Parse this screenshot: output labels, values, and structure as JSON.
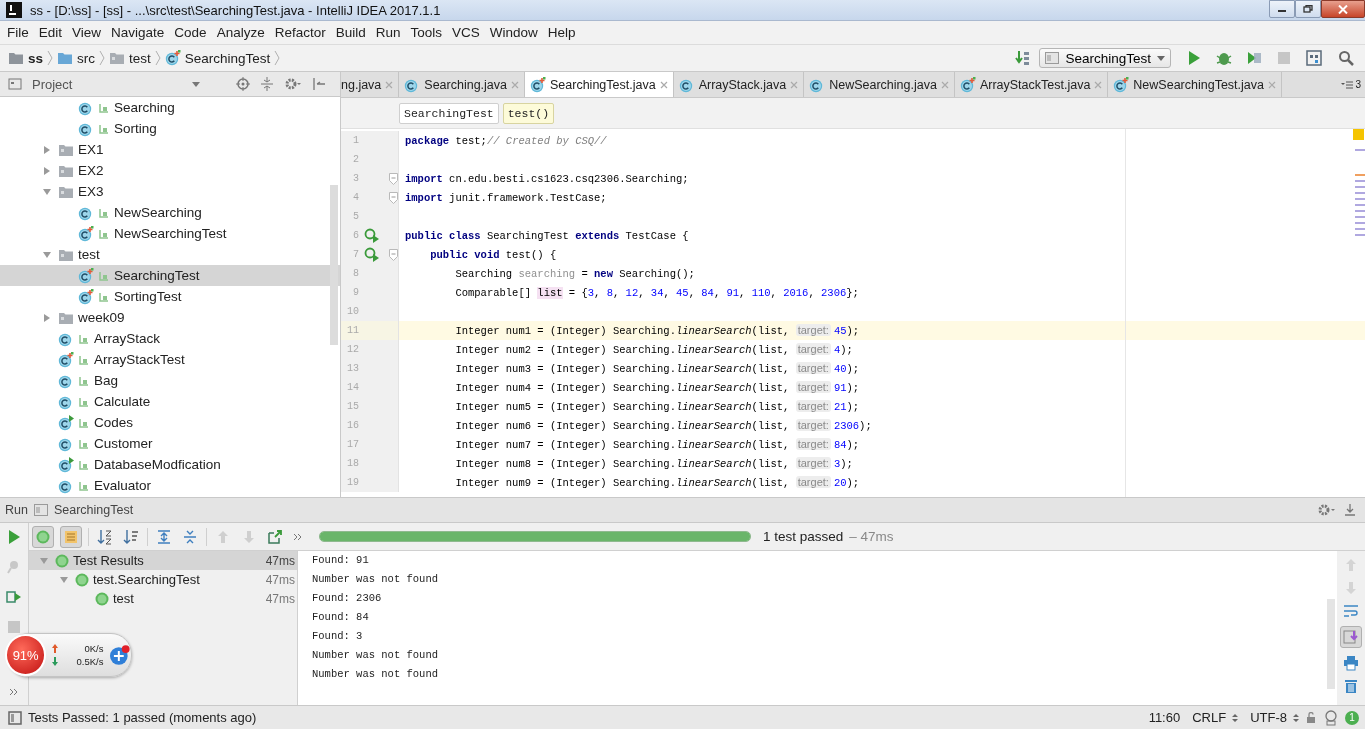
{
  "window": {
    "title": "ss - [D:\\ss] - [ss] - ...\\src\\test\\SearchingTest.java - IntelliJ IDEA 2017.1.1"
  },
  "menu": [
    "File",
    "Edit",
    "View",
    "Navigate",
    "Code",
    "Analyze",
    "Refactor",
    "Build",
    "Run",
    "Tools",
    "VCS",
    "Window",
    "Help"
  ],
  "navigation": {
    "breadcrumbs": [
      {
        "label": "ss",
        "kind": "project"
      },
      {
        "label": "src",
        "kind": "source"
      },
      {
        "label": "test",
        "kind": "folder"
      },
      {
        "label": "SearchingTest",
        "kind": "test"
      }
    ],
    "run_configuration": "SearchingTest"
  },
  "project": {
    "title": "Project",
    "continued": [
      {
        "label": "Searching",
        "kind": "class",
        "selected": false
      },
      {
        "label": "Sorting",
        "kind": "class",
        "selected": false
      }
    ],
    "items": [
      {
        "label": "EX1",
        "kind": "folder",
        "expanded": false,
        "selected": false
      },
      {
        "label": "EX2",
        "kind": "folder",
        "expanded": false,
        "selected": false
      },
      {
        "label": "EX3",
        "kind": "folder",
        "expanded": true,
        "selected": false,
        "children": [
          {
            "label": "NewSearching",
            "kind": "class",
            "selected": false
          },
          {
            "label": "NewSearchingTest",
            "kind": "test",
            "selected": false
          }
        ]
      },
      {
        "label": "test",
        "kind": "folder",
        "expanded": true,
        "selected": false,
        "children": [
          {
            "label": "SearchingTest",
            "kind": "test",
            "selected": true
          },
          {
            "label": "SortingTest",
            "kind": "test",
            "selected": false
          }
        ]
      },
      {
        "label": "week09",
        "kind": "folder",
        "expanded": false,
        "selected": false
      },
      {
        "label": "ArrayStack",
        "kind": "class",
        "selected": false
      },
      {
        "label": "ArrayStackTest",
        "kind": "test",
        "selected": false
      },
      {
        "label": "Bag",
        "kind": "class",
        "selected": false
      },
      {
        "label": "Calculate",
        "kind": "class",
        "selected": false
      },
      {
        "label": "Codes",
        "kind": "main",
        "selected": false
      },
      {
        "label": "Customer",
        "kind": "class",
        "selected": false
      },
      {
        "label": "DatabaseModfication",
        "kind": "main",
        "selected": false
      },
      {
        "label": "Evaluator",
        "kind": "class",
        "selected": false
      }
    ]
  },
  "editor": {
    "tabs": [
      {
        "label": "ng.java",
        "kind": "class",
        "selected": false
      },
      {
        "label": "Searching.java",
        "kind": "class",
        "selected": false
      },
      {
        "label": "SearchingTest.java",
        "kind": "test",
        "selected": true
      },
      {
        "label": "ArrayStack.java",
        "kind": "class",
        "selected": false
      },
      {
        "label": "NewSearching.java",
        "kind": "class",
        "selected": false
      },
      {
        "label": "ArrayStackTest.java",
        "kind": "test",
        "selected": false
      },
      {
        "label": "NewSearchingTest.java",
        "kind": "test",
        "selected": false
      }
    ],
    "hidden_tab_count": "3",
    "crumbs": [
      {
        "label": "SearchingTest",
        "selected": false
      },
      {
        "label": "test()",
        "selected": true
      }
    ],
    "lines": [
      {
        "number": "1",
        "run_marker": false,
        "fold": false,
        "selected": false,
        "tokens": [
          {
            "kind": "keyword",
            "text": "package"
          },
          {
            "kind": "text",
            "text": " test;"
          },
          {
            "kind": "comment",
            "text": "// Created by CSQ//"
          }
        ]
      },
      {
        "number": "2",
        "run_marker": false,
        "fold": false,
        "selected": false
      },
      {
        "number": "3",
        "run_marker": false,
        "fold": true,
        "selected": false,
        "tokens": [
          {
            "kind": "keyword",
            "text": "import"
          },
          {
            "kind": "text",
            "text": " cn.edu.besti.cs1623.csq2306.Searching;"
          }
        ]
      },
      {
        "number": "4",
        "run_marker": false,
        "fold": true,
        "selected": false,
        "tokens": [
          {
            "kind": "keyword",
            "text": "import"
          },
          {
            "kind": "text",
            "text": " junit.framework.TestCase;"
          }
        ]
      },
      {
        "number": "5",
        "run_marker": false,
        "fold": false,
        "selected": false
      },
      {
        "number": "6",
        "run_marker": true,
        "fold": false,
        "selected": false,
        "tokens": [
          {
            "kind": "keyword",
            "text": "public class"
          },
          {
            "kind": "text",
            "text": " SearchingTest "
          },
          {
            "kind": "keyword",
            "text": "extends"
          },
          {
            "kind": "text",
            "text": " TestCase {"
          }
        ]
      },
      {
        "number": "7",
        "run_marker": true,
        "fold": true,
        "selected": false,
        "tokens": [
          {
            "kind": "keyword",
            "text": "    public void"
          },
          {
            "kind": "text",
            "text": " test() {"
          }
        ]
      },
      {
        "number": "8",
        "run_marker": false,
        "fold": false,
        "selected": false,
        "tokens": [
          {
            "kind": "text",
            "text": "        Searching "
          },
          {
            "kind": "unused",
            "text": "searching"
          },
          {
            "kind": "text",
            "text": " = "
          },
          {
            "kind": "keyword",
            "text": "new"
          },
          {
            "kind": "text",
            "text": " Searching();"
          }
        ]
      },
      {
        "number": "9",
        "run_marker": false,
        "fold": false,
        "selected": false,
        "tokens": [
          {
            "kind": "text",
            "text": "        Comparable[] "
          },
          {
            "kind": "variable",
            "text": "list"
          },
          {
            "kind": "text",
            "text": " = {"
          },
          {
            "kind": "number",
            "text": "3"
          },
          {
            "kind": "text",
            "text": ", "
          },
          {
            "kind": "number",
            "text": "8"
          },
          {
            "kind": "text",
            "text": ", "
          },
          {
            "kind": "number",
            "text": "12"
          },
          {
            "kind": "text",
            "text": ", "
          },
          {
            "kind": "number",
            "text": "34"
          },
          {
            "kind": "text",
            "text": ", "
          },
          {
            "kind": "number",
            "text": "45"
          },
          {
            "kind": "text",
            "text": ", "
          },
          {
            "kind": "number",
            "text": "84"
          },
          {
            "kind": "text",
            "text": ", "
          },
          {
            "kind": "number",
            "text": "91"
          },
          {
            "kind": "text",
            "text": ", "
          },
          {
            "kind": "number",
            "text": "110"
          },
          {
            "kind": "text",
            "text": ", "
          },
          {
            "kind": "number",
            "text": "2016"
          },
          {
            "kind": "text",
            "text": ", "
          },
          {
            "kind": "number",
            "text": "2306"
          },
          {
            "kind": "text",
            "text": "};"
          }
        ]
      },
      {
        "number": "10",
        "run_marker": false,
        "fold": false,
        "selected": false
      },
      {
        "number": "11",
        "run_marker": false,
        "fold": false,
        "selected": true,
        "tokens": [
          {
            "kind": "text",
            "text": "        Integer num1 = (Integer) Searching."
          },
          {
            "kind": "call",
            "text": "linearSearch"
          },
          {
            "kind": "text",
            "text": "(list, "
          },
          {
            "kind": "hint",
            "text": "target:"
          },
          {
            "kind": "number",
            "text": "45"
          },
          {
            "kind": "text",
            "text": ");"
          }
        ]
      },
      {
        "number": "12",
        "run_marker": false,
        "fold": false,
        "selected": false,
        "tokens": [
          {
            "kind": "text",
            "text": "        Integer num2 = (Integer) Searching."
          },
          {
            "kind": "call",
            "text": "linearSearch"
          },
          {
            "kind": "text",
            "text": "(list, "
          },
          {
            "kind": "hint",
            "text": "target:"
          },
          {
            "kind": "number",
            "text": "4"
          },
          {
            "kind": "text",
            "text": ");"
          }
        ]
      },
      {
        "number": "13",
        "run_marker": false,
        "fold": false,
        "selected": false,
        "tokens": [
          {
            "kind": "text",
            "text": "        Integer num3 = (Integer) Searching."
          },
          {
            "kind": "call",
            "text": "linearSearch"
          },
          {
            "kind": "text",
            "text": "(list, "
          },
          {
            "kind": "hint",
            "text": "target:"
          },
          {
            "kind": "number",
            "text": "40"
          },
          {
            "kind": "text",
            "text": ");"
          }
        ]
      },
      {
        "number": "14",
        "run_marker": false,
        "fold": false,
        "selected": false,
        "tokens": [
          {
            "kind": "text",
            "text": "        Integer num4 = (Integer) Searching."
          },
          {
            "kind": "call",
            "text": "linearSearch"
          },
          {
            "kind": "text",
            "text": "(list, "
          },
          {
            "kind": "hint",
            "text": "target:"
          },
          {
            "kind": "number",
            "text": "91"
          },
          {
            "kind": "text",
            "text": ");"
          }
        ]
      },
      {
        "number": "15",
        "run_marker": false,
        "fold": false,
        "selected": false,
        "tokens": [
          {
            "kind": "text",
            "text": "        Integer num5 = (Integer) Searching."
          },
          {
            "kind": "call",
            "text": "linearSearch"
          },
          {
            "kind": "text",
            "text": "(list, "
          },
          {
            "kind": "hint",
            "text": "target:"
          },
          {
            "kind": "number",
            "text": "21"
          },
          {
            "kind": "text",
            "text": ");"
          }
        ]
      },
      {
        "number": "16",
        "run_marker": false,
        "fold": false,
        "selected": false,
        "tokens": [
          {
            "kind": "text",
            "text": "        Integer num6 = (Integer) Searching."
          },
          {
            "kind": "call",
            "text": "linearSearch"
          },
          {
            "kind": "text",
            "text": "(list, "
          },
          {
            "kind": "hint",
            "text": "target:"
          },
          {
            "kind": "number",
            "text": "2306"
          },
          {
            "kind": "text",
            "text": ");"
          }
        ]
      },
      {
        "number": "17",
        "run_marker": false,
        "fold": false,
        "selected": false,
        "tokens": [
          {
            "kind": "text",
            "text": "        Integer num7 = (Integer) Searching."
          },
          {
            "kind": "call",
            "text": "linearSearch"
          },
          {
            "kind": "text",
            "text": "(list, "
          },
          {
            "kind": "hint",
            "text": "target:"
          },
          {
            "kind": "number",
            "text": "84"
          },
          {
            "kind": "text",
            "text": ");"
          }
        ]
      },
      {
        "number": "18",
        "run_marker": false,
        "fold": false,
        "selected": false,
        "tokens": [
          {
            "kind": "text",
            "text": "        Integer num8 = (Integer) Searching."
          },
          {
            "kind": "call",
            "text": "linearSearch"
          },
          {
            "kind": "text",
            "text": "(list, "
          },
          {
            "kind": "hint",
            "text": "target:"
          },
          {
            "kind": "number",
            "text": "3"
          },
          {
            "kind": "text",
            "text": ");"
          }
        ]
      },
      {
        "number": "19",
        "run_marker": false,
        "fold": false,
        "selected": false,
        "tokens": [
          {
            "kind": "text",
            "text": "        Integer num9 = (Integer) Searching."
          },
          {
            "kind": "call",
            "text": "linearSearch"
          },
          {
            "kind": "text",
            "text": "(list, "
          },
          {
            "kind": "hint",
            "text": "target:"
          },
          {
            "kind": "number",
            "text": "20"
          },
          {
            "kind": "text",
            "text": ");"
          }
        ]
      }
    ]
  },
  "run": {
    "title": "Run",
    "configuration": "SearchingTest",
    "progress": {
      "level": 1
    },
    "summary": "1 test passed",
    "duration": "– 47ms",
    "results": [
      {
        "label": "Test Results",
        "time": "47ms",
        "selected": true,
        "expanded": true,
        "children": [
          {
            "label": "test.SearchingTest",
            "time": "47ms",
            "selected": false,
            "expanded": true,
            "children": [
              {
                "label": "test",
                "time": "47ms",
                "selected": false
              }
            ]
          }
        ]
      }
    ],
    "console": [
      "Found: 91",
      "Number was not found",
      "Found: 2306",
      "Found: 84",
      "Found: 3",
      "Number was not found",
      "Number was not found"
    ]
  },
  "widget": {
    "percent": "91%",
    "upload": "0K/s",
    "download": "0.5K/s"
  },
  "status": {
    "message": "Tests Passed: 1 passed (moments ago)",
    "position": "11:60",
    "line_separator": "CRLF",
    "encoding": "UTF-8",
    "notifications": "1"
  }
}
